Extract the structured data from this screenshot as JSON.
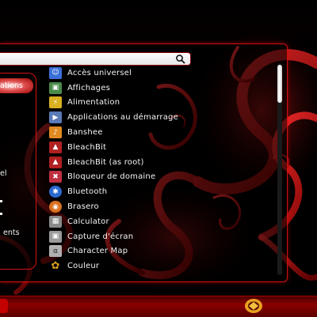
{
  "search": {
    "value": "",
    "placeholder": ""
  },
  "categories": {
    "items": [
      {
        "label": "ations",
        "selected": true
      },
      {
        "label": "el",
        "selected": false
      },
      {
        "label": "ents",
        "selected": false
      }
    ]
  },
  "apps": [
    {
      "label": "Accès universel",
      "icon": "accessibility-icon",
      "color": "#3a6fd8"
    },
    {
      "label": "Affichages",
      "icon": "display-icon",
      "color": "#4a8a4a"
    },
    {
      "label": "Alimentation",
      "icon": "power-icon",
      "color": "#d8b020"
    },
    {
      "label": "Applications au démarrage",
      "icon": "startup-apps-icon",
      "color": "#5a7ab8"
    },
    {
      "label": "Banshee",
      "icon": "banshee-icon",
      "color": "#e08a20"
    },
    {
      "label": "BleachBit",
      "icon": "bleachbit-icon",
      "color": "#b02020"
    },
    {
      "label": "BleachBit (as root)",
      "icon": "bleachbit-root-icon",
      "color": "#b02020"
    },
    {
      "label": "Bloqueur de domaine",
      "icon": "domain-blocker-icon",
      "color": "#c03040"
    },
    {
      "label": "Bluetooth",
      "icon": "bluetooth-icon",
      "color": "#2a6ad0"
    },
    {
      "label": "Brasero",
      "icon": "brasero-icon",
      "color": "#d87020"
    },
    {
      "label": "Calculator",
      "icon": "calculator-icon",
      "color": "#8a8a8a"
    },
    {
      "label": "Capture d'écran",
      "icon": "screenshot-icon",
      "color": "#9a9a9a"
    },
    {
      "label": "Character Map",
      "icon": "character-map-icon",
      "color": "#b0b0b0"
    },
    {
      "label": "Couleur",
      "icon": "color-icon",
      "color": "#e0a020"
    }
  ],
  "colors": {
    "accent": "#d01010",
    "background": "#000000",
    "taskbar": "#8a0000"
  }
}
